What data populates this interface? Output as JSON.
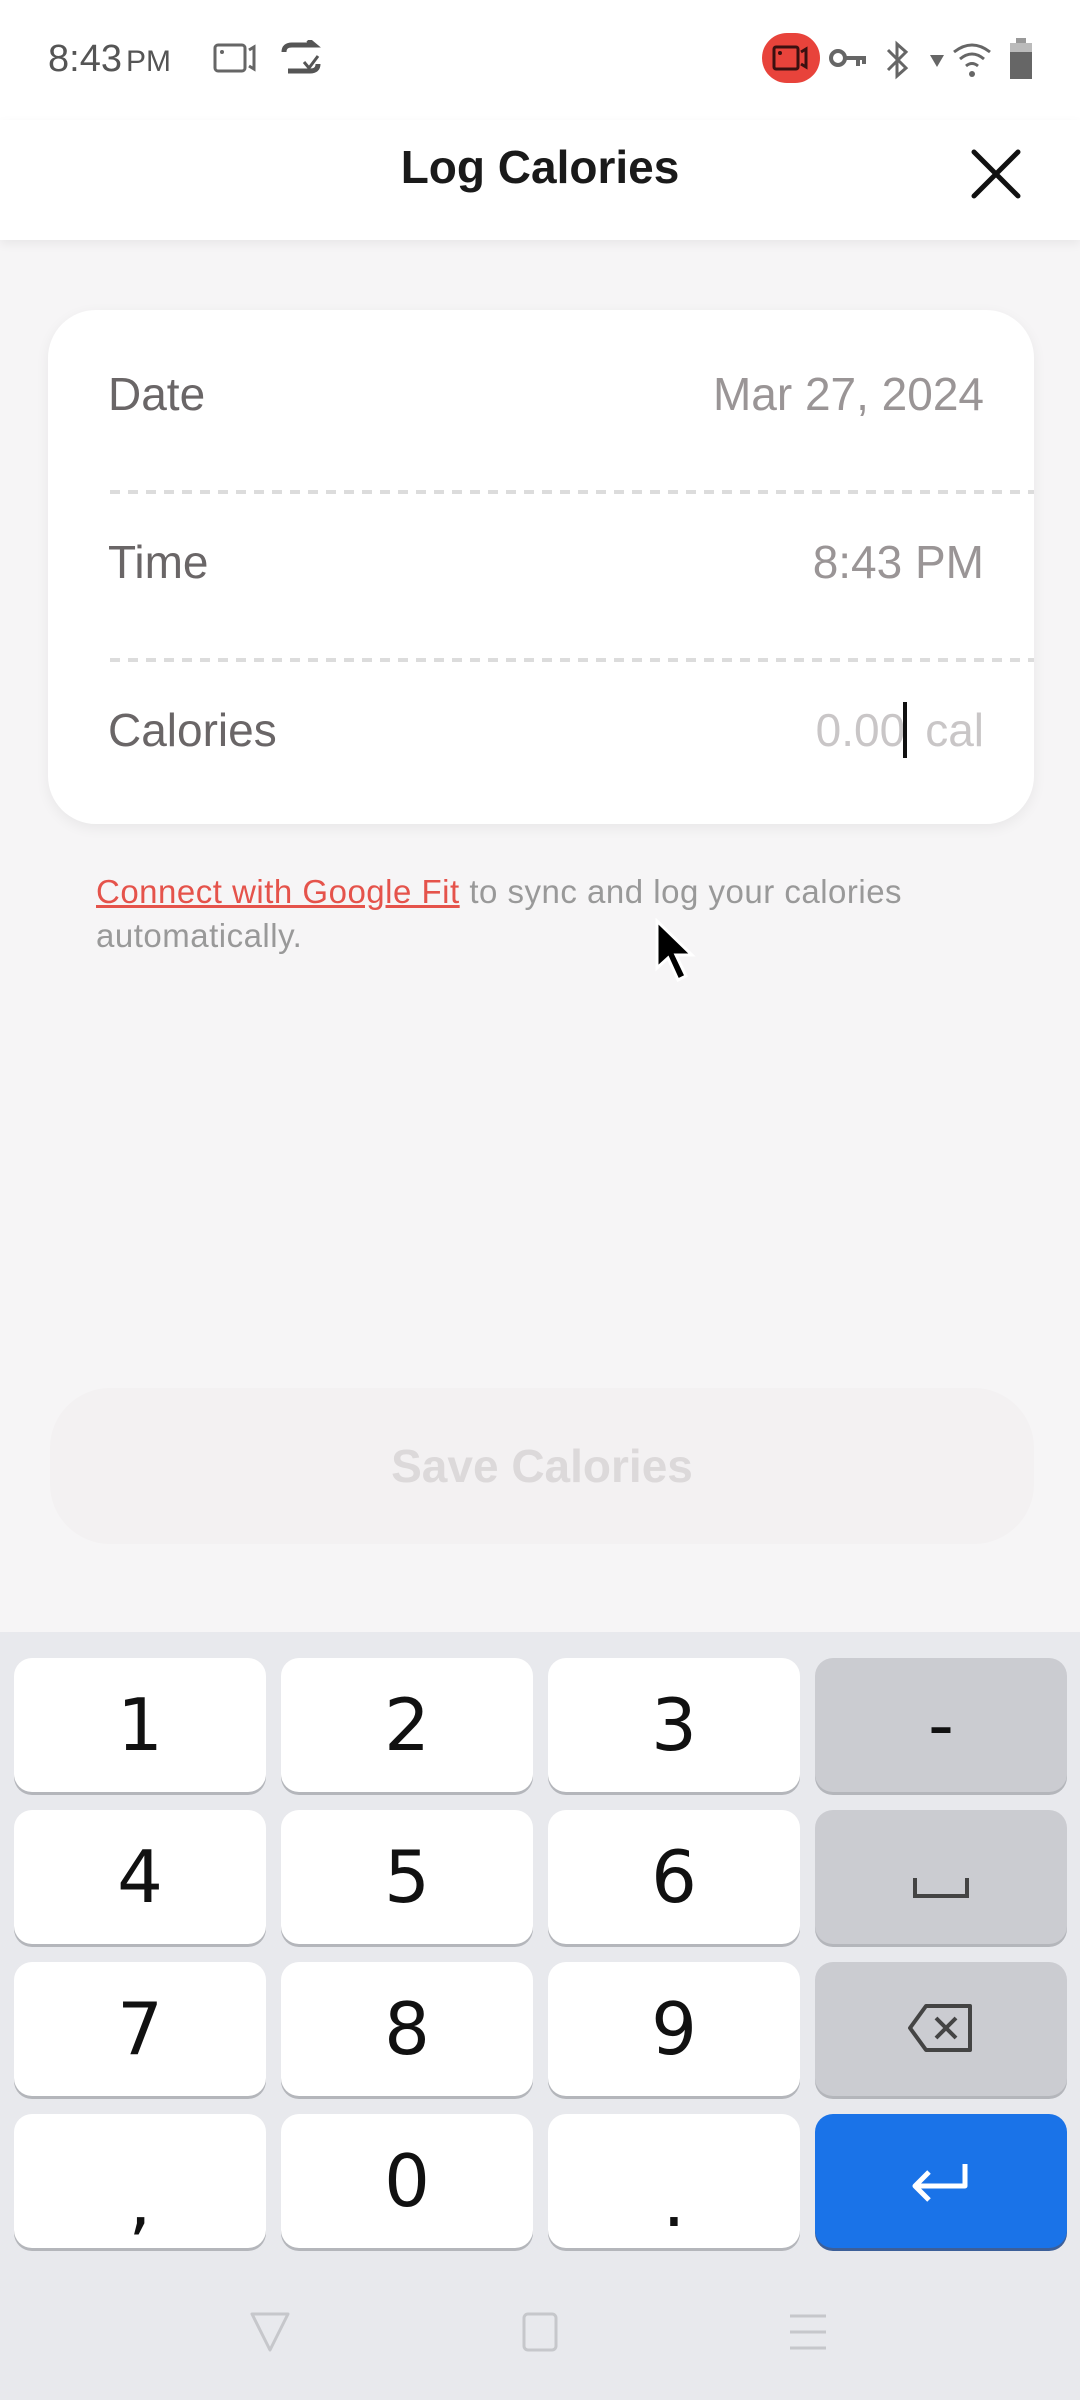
{
  "status_bar": {
    "time": "8:43",
    "ampm": "PM",
    "left_icons": [
      "screen-record-icon",
      "sync-check-icon"
    ],
    "right_icons": [
      "recording-badge-icon",
      "vpn-key-icon",
      "bluetooth-icon",
      "wifi-icon",
      "battery-icon"
    ],
    "recording_color": "#e8433b"
  },
  "header": {
    "title": "Log Calories",
    "close_icon": "close-icon"
  },
  "form": {
    "date_label": "Date",
    "date_value": "Mar 27, 2024",
    "time_label": "Time",
    "time_value": "8:43 PM",
    "calories_label": "Calories",
    "calories_value": "",
    "calories_placeholder": "0.00",
    "calories_unit": "cal"
  },
  "google_fit": {
    "link_text": "Connect with Google Fit",
    "rest_text": " to sync and log your calories automatically.",
    "link_color": "#e5534b"
  },
  "save_button": {
    "label": "Save Calories",
    "enabled": false
  },
  "keyboard": {
    "keys": [
      {
        "label": "1",
        "type": "digit"
      },
      {
        "label": "2",
        "type": "digit"
      },
      {
        "label": "3",
        "type": "digit"
      },
      {
        "label": "-",
        "type": "func"
      },
      {
        "label": "4",
        "type": "digit"
      },
      {
        "label": "5",
        "type": "digit"
      },
      {
        "label": "6",
        "type": "digit"
      },
      {
        "label": "␣",
        "type": "func",
        "icon": "space-icon"
      },
      {
        "label": "7",
        "type": "digit"
      },
      {
        "label": "8",
        "type": "digit"
      },
      {
        "label": "9",
        "type": "digit"
      },
      {
        "label": "",
        "type": "func",
        "icon": "backspace-icon"
      },
      {
        "label": ",",
        "type": "digit"
      },
      {
        "label": "0",
        "type": "digit"
      },
      {
        "label": ".",
        "type": "digit"
      },
      {
        "label": "",
        "type": "enter",
        "icon": "enter-icon"
      }
    ],
    "enter_color": "#1a73e8"
  },
  "nav_bar": {
    "buttons": [
      "back-icon",
      "home-icon",
      "recents-icon"
    ]
  }
}
